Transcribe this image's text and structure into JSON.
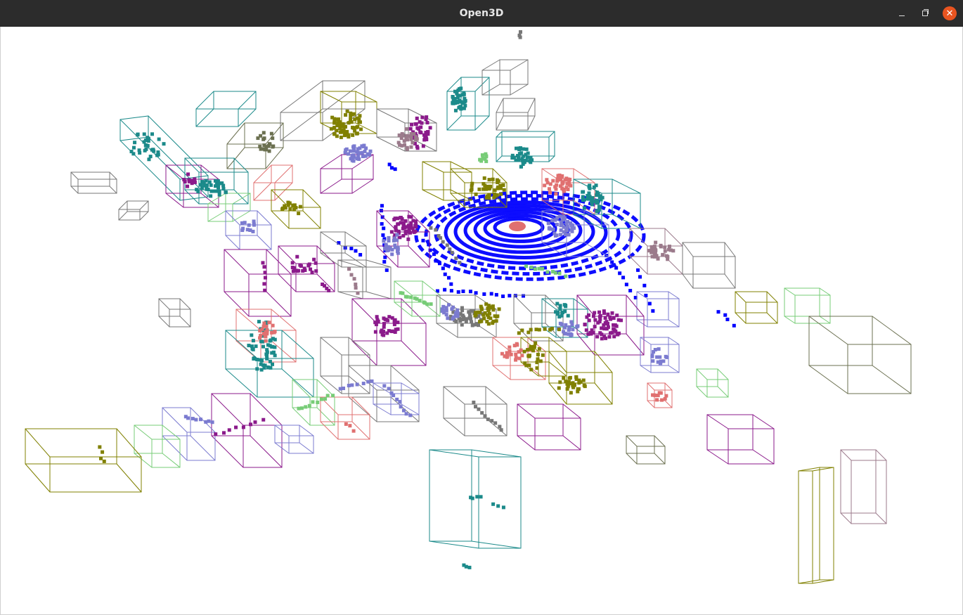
{
  "window": {
    "title": "Open3D",
    "minimize_icon": "minimize-icon",
    "maximize_icon": "maximize-icon",
    "close_icon": "close-icon",
    "close_color": "#e95420",
    "titlebar_color": "#2c2c2c"
  },
  "scene": {
    "background": "#ffffff",
    "lidar_color": "#0000ff",
    "palette": {
      "teal": "#1b8a8a",
      "olive": "#808000",
      "purple": "#8b1a8b",
      "gray": "#777777",
      "salmon": "#e07070",
      "lavender": "#7b7bd0",
      "lightgreen": "#77cc77",
      "mauve": "#9b7a8b",
      "darkolive": "#6b7050"
    }
  }
}
